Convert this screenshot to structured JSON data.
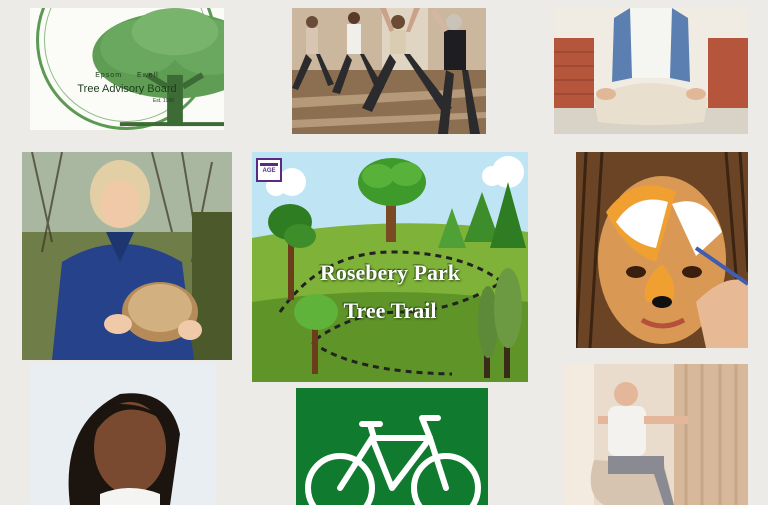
{
  "logo": {
    "place_left": "Epsom",
    "place_right": "Ewell",
    "name": "Tree Advisory Board",
    "established": "Est. 1996"
  },
  "poster": {
    "badge": "AGE",
    "title_line1": "Rosebery Park",
    "title_line2": "Tree Trail"
  },
  "colors": {
    "background": "#ecebe7",
    "logo_green": "#5c9a53",
    "poster_grass": "#7fb238",
    "poster_sky": "#bfe4f4",
    "bike_sign_green": "#107a2e",
    "age_badge_purple": "#5a2a82"
  },
  "icons": {
    "bike": "bicycle-icon",
    "tree": "tree-icon"
  }
}
